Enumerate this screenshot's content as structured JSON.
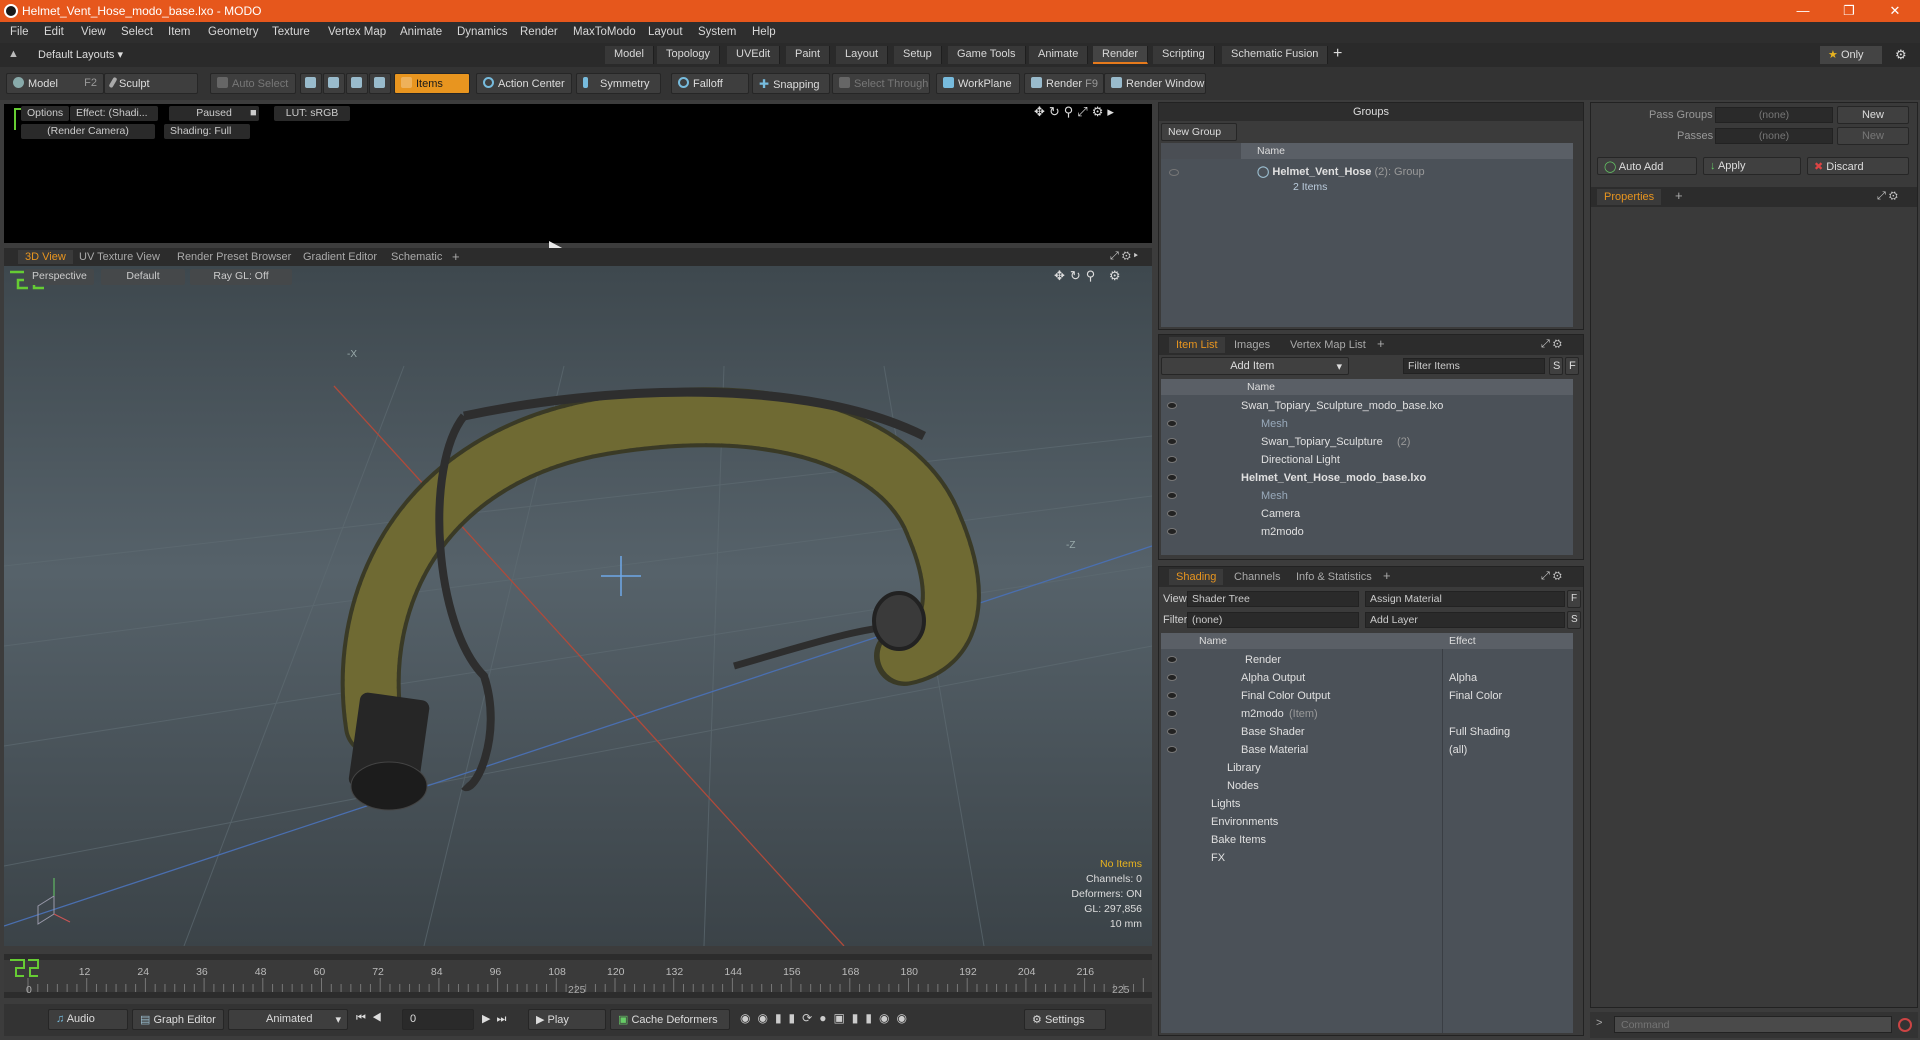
{
  "window": {
    "title": "Helmet_Vent_Hose_modo_base.lxo - MODO"
  },
  "menu": [
    "File",
    "Edit",
    "View",
    "Select",
    "Item",
    "Geometry",
    "Texture",
    "Vertex Map",
    "Animate",
    "Dynamics",
    "Render",
    "MaxToModo",
    "Layout",
    "System",
    "Help"
  ],
  "layouts": {
    "dropdown": "Default Layouts",
    "tabs": [
      "Model",
      "Topology",
      "UVEdit",
      "Paint",
      "Layout",
      "Setup",
      "Game Tools",
      "Animate",
      "Render",
      "Scripting",
      "Schematic Fusion"
    ],
    "active": "Render",
    "only": "Only"
  },
  "toolbar": {
    "model": "Model",
    "model_key": "F2",
    "sculpt": "Sculpt",
    "auto_select": "Auto Select",
    "items": "Items",
    "action_center": "Action Center",
    "symmetry": "Symmetry",
    "falloff": "Falloff",
    "snapping": "Snapping",
    "select_through": "Select Through",
    "workplane": "WorkPlane",
    "render": "Render",
    "render_key": "F9",
    "render_window": "Render Window"
  },
  "preview": {
    "options": "Options",
    "effect": "Effect: (Shadi...",
    "paused": "Paused",
    "lut": "LUT: sRGB",
    "camera": "(Render Camera)",
    "shading": "Shading: Full"
  },
  "viewtabs": [
    "3D View",
    "UV Texture View",
    "Render Preset Browser",
    "Gradient Editor",
    "Schematic"
  ],
  "viewport": {
    "perspective": "Perspective",
    "default": "Default",
    "raygl": "Ray GL: Off",
    "info": [
      "No Items",
      "Channels: 0",
      "Deformers: ON",
      "GL: 297,856",
      "10 mm"
    ],
    "axis_x": "-X",
    "axis_z": "-Z"
  },
  "timeline": {
    "ticks": [
      "0",
      "12",
      "24",
      "36",
      "48",
      "60",
      "72",
      "84",
      "96",
      "108",
      "120",
      "132",
      "144",
      "156",
      "168",
      "180",
      "192",
      "204",
      "216"
    ],
    "start": "0",
    "end": "225",
    "mid": "225"
  },
  "bottom": {
    "audio": "Audio",
    "graph": "Graph Editor",
    "animated": "Animated",
    "frame": "0",
    "play": "Play",
    "cache": "Cache Deformers",
    "settings": "Settings"
  },
  "groups": {
    "title": "Groups",
    "new_group": "New Group",
    "col_name": "Name",
    "item_name": "Helmet_Vent_Hose",
    "item_count": "(2)",
    "item_type": ": Group",
    "item_sub": "2 Items"
  },
  "passes": {
    "pass_groups": "Pass Groups",
    "passes": "Passes",
    "none1": "(none)",
    "none2": "(none)",
    "new1": "New",
    "new2": "New",
    "auto_add": "Auto Add",
    "apply": "Apply",
    "discard": "Discard",
    "properties": "Properties"
  },
  "itemlist": {
    "tabs": [
      "Item List",
      "Images",
      "Vertex Map List"
    ],
    "add_item": "Add Item",
    "filter": "Filter Items",
    "col_name": "Name",
    "rows": [
      {
        "label": "Swan_Topiary_Sculpture_modo_base.lxo",
        "indent": 0,
        "bold": false,
        "dim": false
      },
      {
        "label": "Mesh",
        "indent": 1,
        "bold": false,
        "dim": true
      },
      {
        "label": "Swan_Topiary_Sculpture",
        "suffix": "(2)",
        "indent": 1,
        "bold": false,
        "dim": false
      },
      {
        "label": "Directional Light",
        "indent": 1,
        "bold": false,
        "dim": false
      },
      {
        "label": "Helmet_Vent_Hose_modo_base.lxo",
        "indent": 0,
        "bold": true,
        "dim": false
      },
      {
        "label": "Mesh",
        "indent": 1,
        "bold": false,
        "dim": true
      },
      {
        "label": "Camera",
        "indent": 1,
        "bold": false,
        "dim": false
      },
      {
        "label": "m2modo",
        "indent": 1,
        "bold": false,
        "dim": false
      }
    ]
  },
  "shading": {
    "tabs": [
      "Shading",
      "Channels",
      "Info & Statistics"
    ],
    "view_label": "View",
    "view_value": "Shader Tree",
    "assign": "Assign Material",
    "filter_label": "Filter",
    "filter_value": "(none)",
    "add_layer": "Add Layer",
    "col_name": "Name",
    "col_effect": "Effect",
    "rows": [
      {
        "label": "Render",
        "effect": ""
      },
      {
        "label": "Alpha Output",
        "effect": "Alpha"
      },
      {
        "label": "Final Color Output",
        "effect": "Final Color"
      },
      {
        "label": "m2modo",
        "suffix": "(Item)",
        "effect": ""
      },
      {
        "label": "Base Shader",
        "effect": "Full Shading"
      },
      {
        "label": "Base Material",
        "effect": "(all)"
      },
      {
        "label": "Library",
        "effect": ""
      },
      {
        "label": "Nodes",
        "effect": ""
      },
      {
        "label": "Lights",
        "effect": ""
      },
      {
        "label": "Environments",
        "effect": ""
      },
      {
        "label": "Bake Items",
        "effect": ""
      },
      {
        "label": "FX",
        "effect": ""
      }
    ]
  },
  "command": {
    "placeholder": "Command"
  }
}
